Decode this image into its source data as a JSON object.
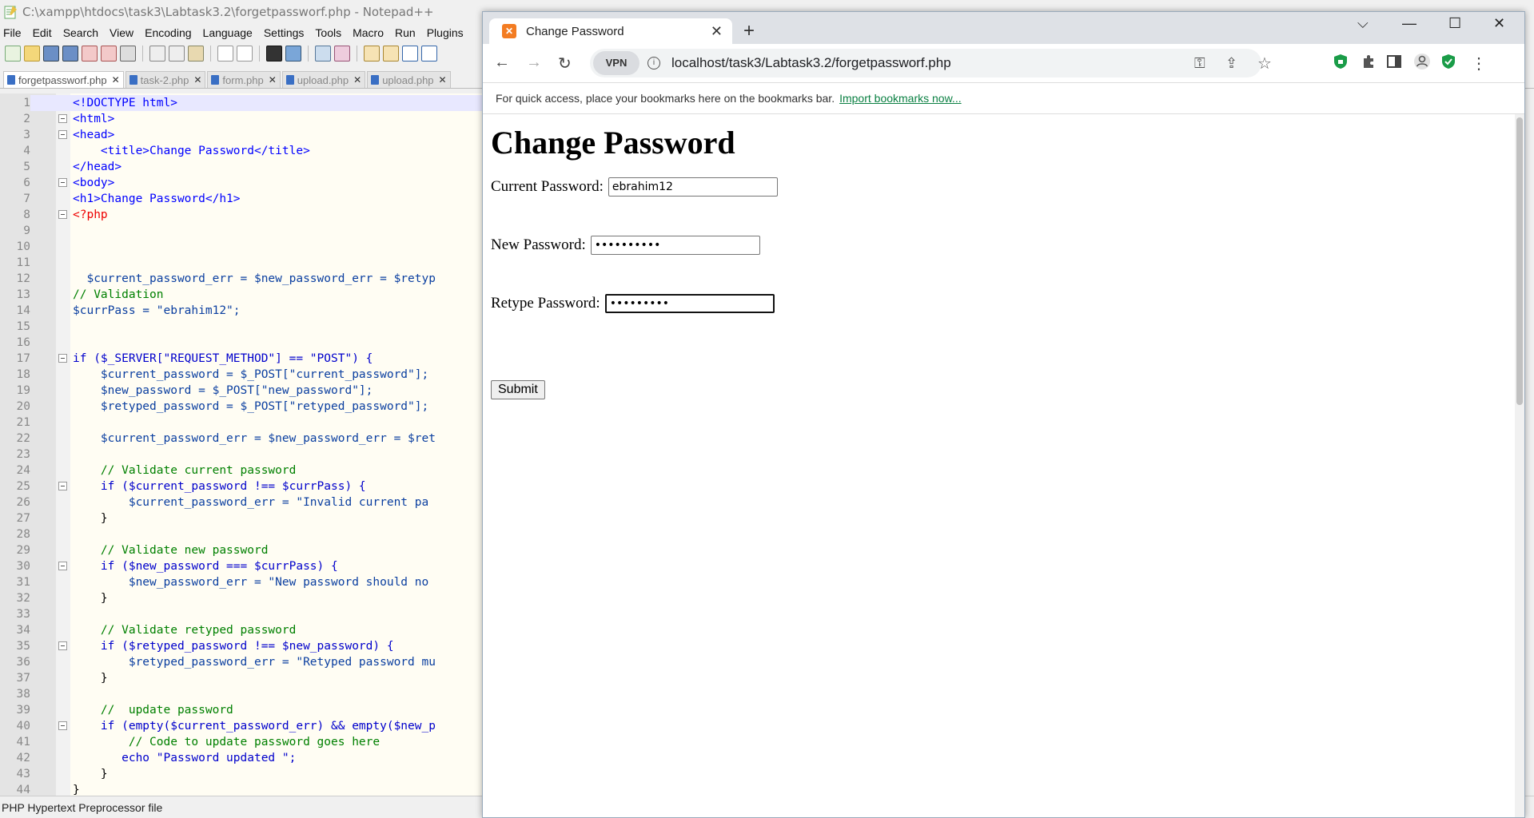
{
  "notepad": {
    "title": "C:\\xampp\\htdocs\\task3\\Labtask3.2\\forgetpassworf.php - Notepad++",
    "menu": [
      "File",
      "Edit",
      "Search",
      "View",
      "Encoding",
      "Language",
      "Settings",
      "Tools",
      "Macro",
      "Run",
      "Plugins"
    ],
    "tabs": [
      "forgetpassworf.php",
      "task-2.php",
      "form.php",
      "upload.php",
      "upload.php"
    ],
    "lines": [
      {
        "n": "1",
        "code": "<!DOCTYPE html>"
      },
      {
        "n": "2",
        "code": "<html>"
      },
      {
        "n": "3",
        "code": "<head>"
      },
      {
        "n": "4",
        "code": "    <title>Change Password</title>"
      },
      {
        "n": "5",
        "code": "</head>"
      },
      {
        "n": "6",
        "code": "<body>"
      },
      {
        "n": "7",
        "code": "<h1>Change Password</h1>"
      },
      {
        "n": "8",
        "code": "<?php"
      },
      {
        "n": "9",
        "code": ""
      },
      {
        "n": "10",
        "code": ""
      },
      {
        "n": "11",
        "code": ""
      },
      {
        "n": "12",
        "code": "  $current_password_err = $new_password_err = $retyp"
      },
      {
        "n": "13",
        "code": "// Validation"
      },
      {
        "n": "14",
        "code": "$currPass = \"ebrahim12\";"
      },
      {
        "n": "15",
        "code": ""
      },
      {
        "n": "16",
        "code": ""
      },
      {
        "n": "17",
        "code": "if ($_SERVER[\"REQUEST_METHOD\"] == \"POST\") {"
      },
      {
        "n": "18",
        "code": "    $current_password = $_POST[\"current_password\"];"
      },
      {
        "n": "19",
        "code": "    $new_password = $_POST[\"new_password\"];"
      },
      {
        "n": "20",
        "code": "    $retyped_password = $_POST[\"retyped_password\"];"
      },
      {
        "n": "21",
        "code": ""
      },
      {
        "n": "22",
        "code": "    $current_password_err = $new_password_err = $ret"
      },
      {
        "n": "23",
        "code": ""
      },
      {
        "n": "24",
        "code": "    // Validate current password"
      },
      {
        "n": "25",
        "code": "    if ($current_password !== $currPass) {"
      },
      {
        "n": "26",
        "code": "        $current_password_err = \"Invalid current pa"
      },
      {
        "n": "27",
        "code": "    }"
      },
      {
        "n": "28",
        "code": ""
      },
      {
        "n": "29",
        "code": "    // Validate new password"
      },
      {
        "n": "30",
        "code": "    if ($new_password === $currPass) {"
      },
      {
        "n": "31",
        "code": "        $new_password_err = \"New password should no"
      },
      {
        "n": "32",
        "code": "    }"
      },
      {
        "n": "33",
        "code": ""
      },
      {
        "n": "34",
        "code": "    // Validate retyped password"
      },
      {
        "n": "35",
        "code": "    if ($retyped_password !== $new_password) {"
      },
      {
        "n": "36",
        "code": "        $retyped_password_err = \"Retyped password mu"
      },
      {
        "n": "37",
        "code": "    }"
      },
      {
        "n": "38",
        "code": ""
      },
      {
        "n": "39",
        "code": "    //  update password"
      },
      {
        "n": "40",
        "code": "    if (empty($current_password_err) && empty($new_p"
      },
      {
        "n": "41",
        "code": "        // Code to update password goes here"
      },
      {
        "n": "42",
        "code": "       echo \"Password updated \";"
      },
      {
        "n": "43",
        "code": "    }"
      },
      {
        "n": "44",
        "code": "}"
      }
    ],
    "status": "PHP Hypertext Preprocessor file"
  },
  "browser": {
    "tab_title": "Change Password",
    "url": "localhost/task3/Labtask3.2/forgetpassworf.php",
    "vpn_label": "VPN",
    "bookmarks_text": "For quick access, place your bookmarks here on the bookmarks bar.",
    "import_link": "Import bookmarks now...",
    "page": {
      "heading": "Change Password",
      "current_label": "Current Password:",
      "current_value": "ebrahim12",
      "new_label": "New Password:",
      "new_value": "••••••••••",
      "retype_label": "Retype Password:",
      "retype_value": "•••••••••",
      "submit_label": "Submit"
    }
  }
}
